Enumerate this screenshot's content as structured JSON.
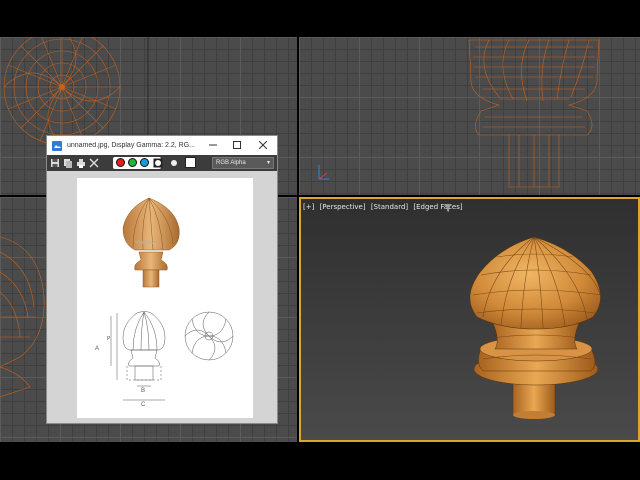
{
  "image_viewer": {
    "title": "unnamed.jpg, Display Gamma: 2.2, RG...",
    "channel_select": "RGB Alpha",
    "toolbar_icons": [
      "save-icon",
      "copy-icon",
      "print-icon",
      "clear-icon"
    ],
    "channel_swatches": [
      {
        "name": "red-channel",
        "color": "#e0201c"
      },
      {
        "name": "green-channel",
        "color": "#1fb83a"
      },
      {
        "name": "blue-channel",
        "color": "#1a9ad6"
      }
    ],
    "window_controls": [
      "minimize-icon",
      "maximize-icon",
      "close-icon"
    ],
    "drawing_labels": {
      "A": "A",
      "B": "B",
      "C": "C",
      "P": "P"
    }
  },
  "perspective_viewport": {
    "labels": [
      "[+]",
      "[Perspective]",
      "[Standard]",
      "[Edged Faces]"
    ]
  },
  "colors": {
    "wireframe": "#d2691e",
    "wood": "#d9963f",
    "active_border": "#d8a82a"
  }
}
